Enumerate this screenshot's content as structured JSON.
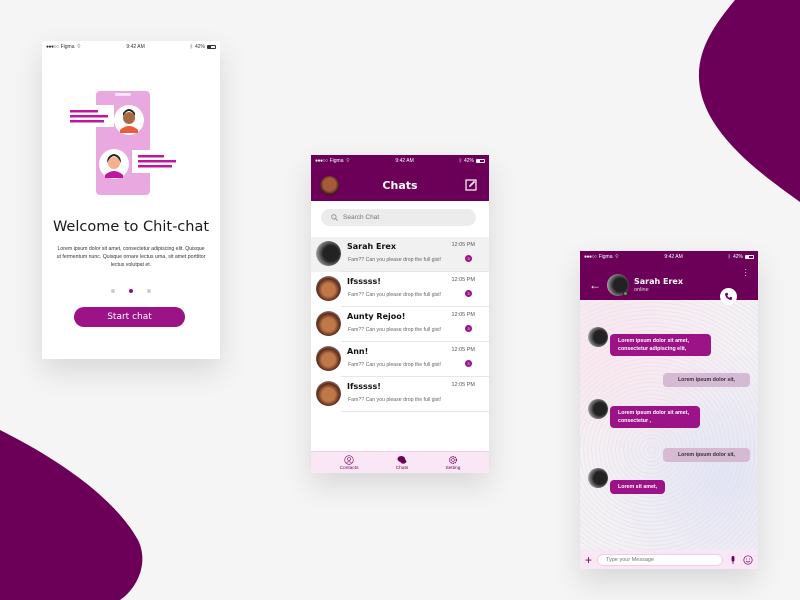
{
  "colors": {
    "brand": "#6c0058",
    "accent": "#9c1287",
    "out_bubble": "#d6b9d3",
    "online": "#2ab54a"
  },
  "statusbar": {
    "carrier": "Figma",
    "time": "9:42 AM",
    "battery": "42%"
  },
  "onboarding": {
    "title": "Welcome to Chit-chat",
    "body": "Lorem ipsum dolor sit amet, consectetur adipiscing elit. Quisque ut fermentum nunc. Quisque ornare lectus urna, sit amet porttitor lectus volutpat et.",
    "pager": {
      "count": 3,
      "active_index": 1
    },
    "start_button": "Start chat"
  },
  "chats_screen": {
    "title": "Chats",
    "search_placeholder": "Search Chat",
    "items": [
      {
        "name": "Sarah Erex",
        "preview": "Fam?? Can you please drop the full gist!",
        "time": "12:05 PM",
        "badge": "3",
        "avatar": "dark"
      },
      {
        "name": "Ifsssss!",
        "preview": "Fam?? Can you please drop the full gist!",
        "time": "12:05 PM",
        "badge": "3",
        "avatar": "face"
      },
      {
        "name": "Aunty Rejoo!",
        "preview": "Fam?? Can you please drop the full gist!",
        "time": "12:05 PM",
        "badge": "3",
        "avatar": "face"
      },
      {
        "name": "Ann!",
        "preview": "Fam?? Can you please drop the full gist!",
        "time": "12:05 PM",
        "badge": "3",
        "avatar": "face"
      },
      {
        "name": "Ifsssss!",
        "preview": "Fam?? Can you please drop the full gist!",
        "time": "12:05 PM",
        "badge": "",
        "avatar": "face"
      }
    ],
    "tabs": [
      {
        "label": "Contacts",
        "icon": "contact-icon"
      },
      {
        "label": "Chats",
        "icon": "chat-bubbles-icon"
      },
      {
        "label": "Setting",
        "icon": "gear-icon"
      }
    ]
  },
  "conversation": {
    "contact_name": "Sarah Erex",
    "contact_status": "online",
    "messages": [
      {
        "dir": "in",
        "text": "Lorem ipsum dolor sit amet, consectetur adipiscing elit,"
      },
      {
        "dir": "out",
        "text": "Lorem ipsum dolor sit,"
      },
      {
        "dir": "in",
        "text": "Lorem ipsum dolor sit amet, consectetur ,"
      },
      {
        "dir": "out",
        "text": "Lorem ipsum dolor sit,"
      },
      {
        "dir": "in",
        "text": "Lorem sit amet,"
      }
    ],
    "input_placeholder": "Type your Message"
  }
}
